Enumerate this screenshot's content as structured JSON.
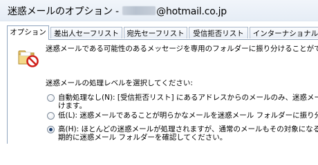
{
  "window": {
    "title_prefix": "迷惑メールのオプション - ",
    "title_suffix": "@hotmail.co.jp"
  },
  "tabs": [
    {
      "label": "オプション",
      "active": true
    },
    {
      "label": "差出人セーフリスト",
      "active": false
    },
    {
      "label": "宛先セーフリスト",
      "active": false
    },
    {
      "label": "受信拒否リスト",
      "active": false
    },
    {
      "label": "インターナショナル",
      "active": false
    }
  ],
  "options": {
    "icon": "junk-folder-icon",
    "description": "迷惑メールである可能性のあるメッセージを専用のフォルダーに振り分けることができます",
    "level_label": "迷惑メールの処理レベルを選択してください:",
    "levels": [
      {
        "line1": "自動処理なし(N): [受信拒否リスト] にあるアドレスからのメールのみ、迷惑メール",
        "line2": "けます。",
        "selected": false
      },
      {
        "line1": "低(L): 迷惑メールであることが明らかなメールを迷惑メール フォルダーに振り分けます",
        "line2": "",
        "selected": false
      },
      {
        "line1": "高(H): ほとんどの迷惑メールが処理されますが、通常のメールもその対象になる可",
        "line2": "期的に迷惑メール フォルダーを確認してください。",
        "selected": true
      }
    ]
  }
}
